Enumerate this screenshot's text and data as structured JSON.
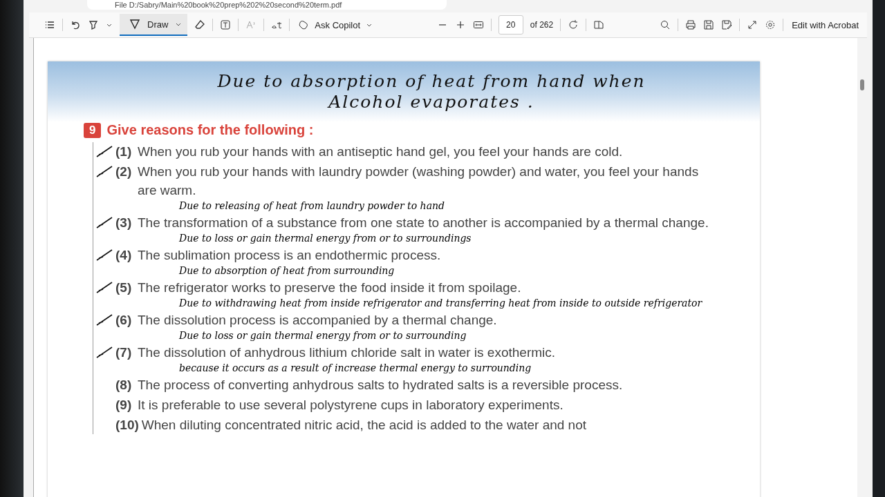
{
  "address_bar": {
    "text": "File  D:/Sabry/Main%20book%20prep%202%20second%20term.pdf"
  },
  "toolbar": {
    "draw_label": "Draw",
    "copilot_label": "Ask Copilot",
    "page_number": "20",
    "page_count": "of 262",
    "edit_label": "Edit with Acrobat"
  },
  "page": {
    "header_note": "Due to absorption of heat from hand when Alcohol evaporates .",
    "section": {
      "number": "9",
      "title": "Give reasons for the following :"
    },
    "items": [
      {
        "number": "(1)",
        "text": "When you rub your hands with an antiseptic hand gel, you feel your hands are cold.",
        "struck": true
      },
      {
        "number": "(2)",
        "text": "When you rub your hands with laundry powder (washing powder) and water, you feel your hands are warm.",
        "struck": true,
        "note": "Due to releasing of heat from laundry powder to hand"
      },
      {
        "number": "(3)",
        "text": "The transformation of a substance from one state to another is accompanied by a thermal change.",
        "struck": true,
        "note": "Due to loss or gain thermal energy from or to surroundings"
      },
      {
        "number": "(4)",
        "text": "The sublimation process is an endothermic process.",
        "struck": true,
        "note": "Due to absorption of heat from surrounding"
      },
      {
        "number": "(5)",
        "text": "The refrigerator works to preserve the food inside it from spoilage.",
        "struck": true,
        "note": "Due to withdrawing heat from inside refrigerator and transferring heat from inside to outside refrigerator"
      },
      {
        "number": "(6)",
        "text": "The dissolution process is accompanied by a thermal change.",
        "struck": true,
        "note": "Due to loss or gain thermal energy from or to surrounding"
      },
      {
        "number": "(7)",
        "text": "The dissolution of anhydrous lithium chloride salt in water is exothermic.",
        "struck": true,
        "note": "because it occurs as a result of increase thermal energy to surrounding"
      },
      {
        "number": "(8)",
        "text": "The process of converting anhydrous salts to hydrated salts is a reversible process.",
        "struck": false
      },
      {
        "number": "(9)",
        "text": "It is preferable to use several polystyrene cups in laboratory experiments.",
        "struck": false
      },
      {
        "number": "(10)",
        "text": "When diluting concentrated nitric acid, the acid is added to the water and not",
        "struck": false
      }
    ]
  }
}
